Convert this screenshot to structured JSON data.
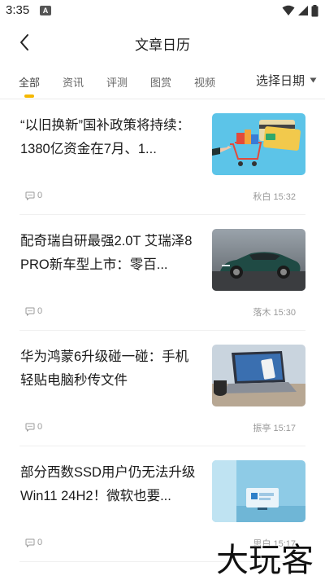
{
  "status_bar": {
    "time": "3:35",
    "app_icon_letter": "A"
  },
  "header": {
    "title": "文章日历"
  },
  "tabs": [
    {
      "label": "全部",
      "active": true
    },
    {
      "label": "资讯",
      "active": false
    },
    {
      "label": "评测",
      "active": false
    },
    {
      "label": "图赏",
      "active": false
    },
    {
      "label": "视频",
      "active": false
    }
  ],
  "date_picker": {
    "label": "选择日期"
  },
  "articles": [
    {
      "title": "“以旧换新”国补政策将持续：1380亿资金在7月、1...",
      "comments": "0",
      "author": "秋白",
      "time": "15:32",
      "thumb": "shopping-cart-cards-illustration"
    },
    {
      "title": "配奇瑞自研最强2.0T 艾瑞泽8 PRO新车型上市：零百...",
      "comments": "0",
      "author": "落木",
      "time": "15:30",
      "thumb": "green-sedan-photo"
    },
    {
      "title": "华为鸿蒙6升级碰一碰：手机轻贴电脑秒传文件",
      "comments": "0",
      "author": "振亭",
      "time": "15:17",
      "thumb": "laptop-phone-photo"
    },
    {
      "title": "部分西数SSD用户仍无法升级Win11 24H2！微软也要...",
      "comments": "0",
      "author": "思白",
      "time": "15:17",
      "thumb": "windows-11-room-illustration"
    }
  ],
  "watermark": "大玩客",
  "colors": {
    "accent": "#f5b800",
    "muted_text": "#999999",
    "thumb1_bg": "#5cc4e8",
    "thumb2_bg": "#6f7378",
    "thumb3_bg": "#c9d4de",
    "thumb4_bg": "#8ecbe6"
  }
}
